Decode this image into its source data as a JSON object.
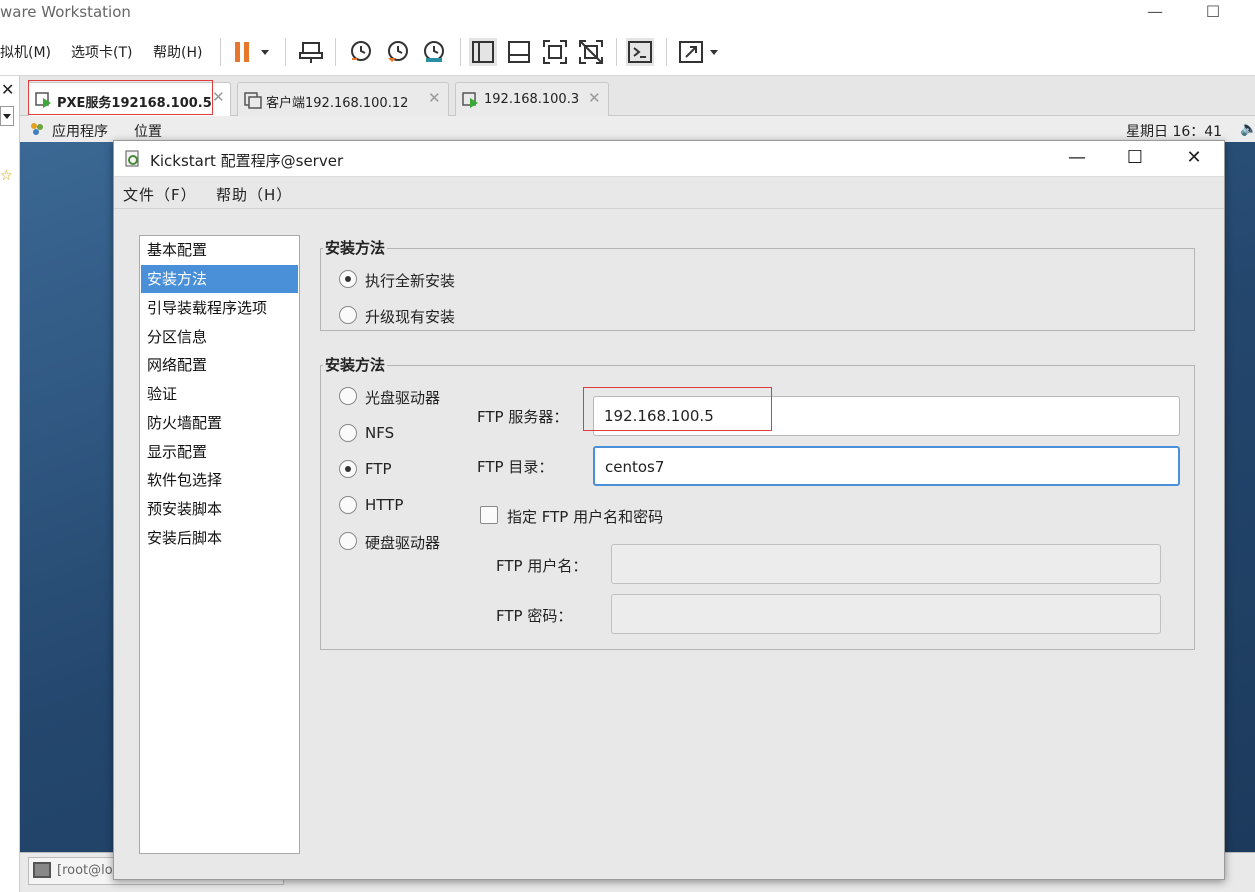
{
  "app": {
    "title": "ware Workstation"
  },
  "menu": {
    "vm": "拟机(M)",
    "tabs": "选项卡(T)",
    "help": "帮助(H)"
  },
  "tabs": [
    {
      "label": "PXE服务192168.100.5",
      "active": true
    },
    {
      "label": "客户端192.168.100.12",
      "active": false
    },
    {
      "label": "192.168.100.3",
      "active": false
    }
  ],
  "gnome": {
    "applications": "应用程序",
    "places": "位置",
    "clock": "星期日 16：41",
    "taskbar_item": "[root@lo"
  },
  "kickstart": {
    "window_title": "Kickstart 配置程序@server",
    "menu": {
      "file": "文件（F）",
      "help": "帮助（H）"
    },
    "nav": [
      "基本配置",
      "安装方法",
      "引导装载程序选项",
      "分区信息",
      "网络配置",
      "验证",
      "防火墙配置",
      "显示配置",
      "软件包选择",
      "预安装脚本",
      "安装后脚本"
    ],
    "selected_nav": "安装方法",
    "install_group": {
      "title": "安装方法",
      "options": [
        "执行全新安装",
        "升级现有安装"
      ],
      "selected": "执行全新安装"
    },
    "method_group": {
      "title": "安装方法",
      "options": [
        "光盘驱动器",
        "NFS",
        "FTP",
        "HTTP",
        "硬盘驱动器"
      ],
      "selected": "FTP",
      "ftp_server_label": "FTP 服务器：",
      "ftp_server_value": "192.168.100.5",
      "ftp_dir_label": "FTP 目录：",
      "ftp_dir_value": "centos7",
      "credentials_checkbox": "指定 FTP 用户名和密码",
      "credentials_checked": false,
      "ftp_user_label": "FTP 用户名：",
      "ftp_user_value": "",
      "ftp_password_label": "FTP 密码：",
      "ftp_password_value": ""
    }
  },
  "colors": {
    "selection": "#4a90d9",
    "highlight_box": "#e03c3c",
    "pause_icon": "#e8762b"
  }
}
